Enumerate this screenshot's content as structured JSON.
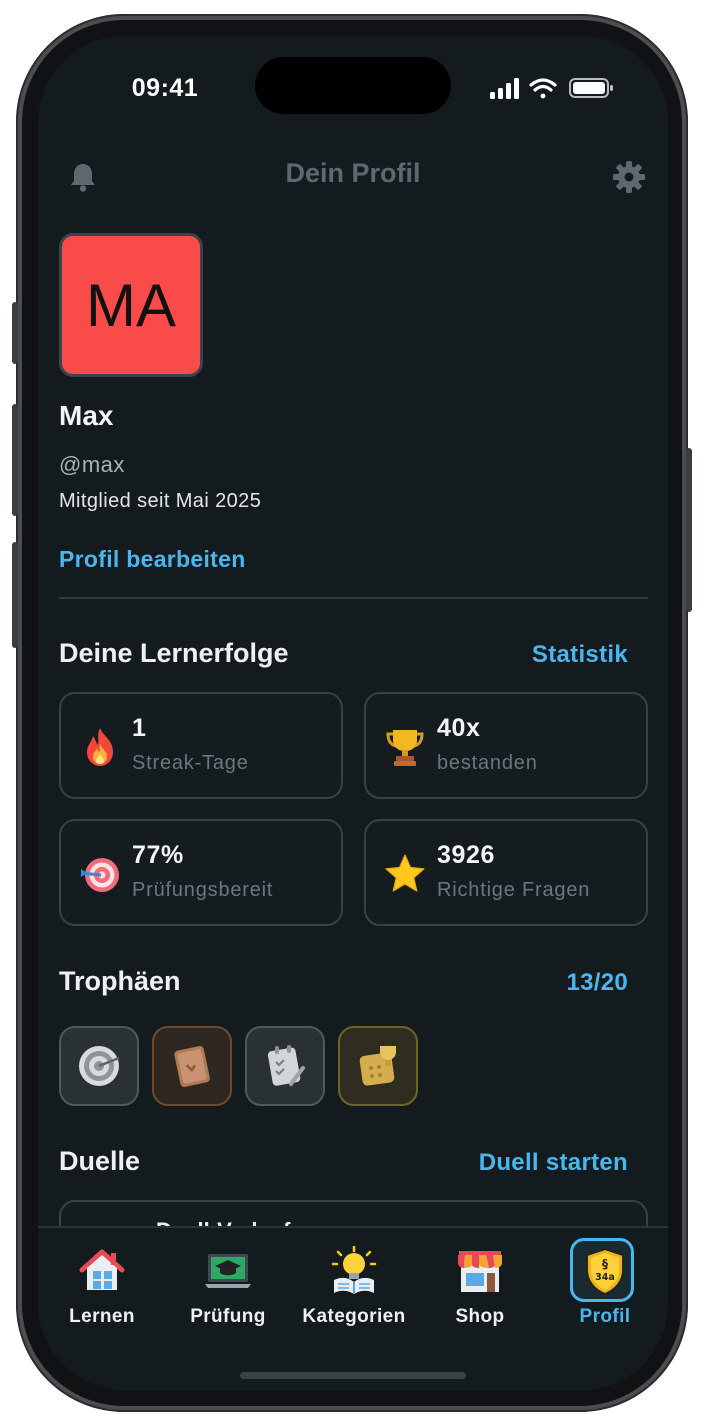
{
  "status_bar": {
    "time": "09:41"
  },
  "header": {
    "title": "Dein Profil",
    "bell_icon": "bell-icon",
    "settings_icon": "gear-icon"
  },
  "profile": {
    "initials": "MA",
    "avatar_color": "#fa4b4b",
    "name": "Max",
    "handle": "@max",
    "member_since": "Mitglied seit Mai 2025",
    "edit_label": "Profil bearbeiten"
  },
  "achievements": {
    "title": "Deine Lernerfolge",
    "link": "Statistik",
    "stats": [
      {
        "value": "1",
        "label": "Streak-Tage",
        "icon": "fire-icon"
      },
      {
        "value": "40x",
        "label": "bestanden",
        "icon": "trophy-icon"
      },
      {
        "value": "77%",
        "label": "Prüfungsbereit",
        "icon": "target-icon"
      },
      {
        "value": "3926",
        "label": "Richtige Fragen",
        "icon": "star-icon"
      }
    ]
  },
  "trophies": {
    "title": "Trophäen",
    "count": "13/20",
    "items": [
      {
        "icon": "target-trophy-icon",
        "tier": "silver"
      },
      {
        "icon": "book-trophy-icon",
        "tier": "bronze"
      },
      {
        "icon": "checklist-trophy-icon",
        "tier": "silver"
      },
      {
        "icon": "calendar-trophy-icon",
        "tier": "gold"
      }
    ]
  },
  "duels": {
    "title": "Duelle",
    "link": "Duell starten",
    "first_card_label": "Duell-Verlauf"
  },
  "tabbar": {
    "active": "Profil",
    "accent": "#4ab6ee",
    "tabs": [
      {
        "label": "Lernen",
        "icon": "house-icon"
      },
      {
        "label": "Prüfung",
        "icon": "laptop-graduation-icon"
      },
      {
        "label": "Kategorien",
        "icon": "lightbulb-book-icon"
      },
      {
        "label": "Shop",
        "icon": "shop-icon"
      },
      {
        "label": "Profil",
        "icon": "shield-34a-icon"
      }
    ]
  }
}
